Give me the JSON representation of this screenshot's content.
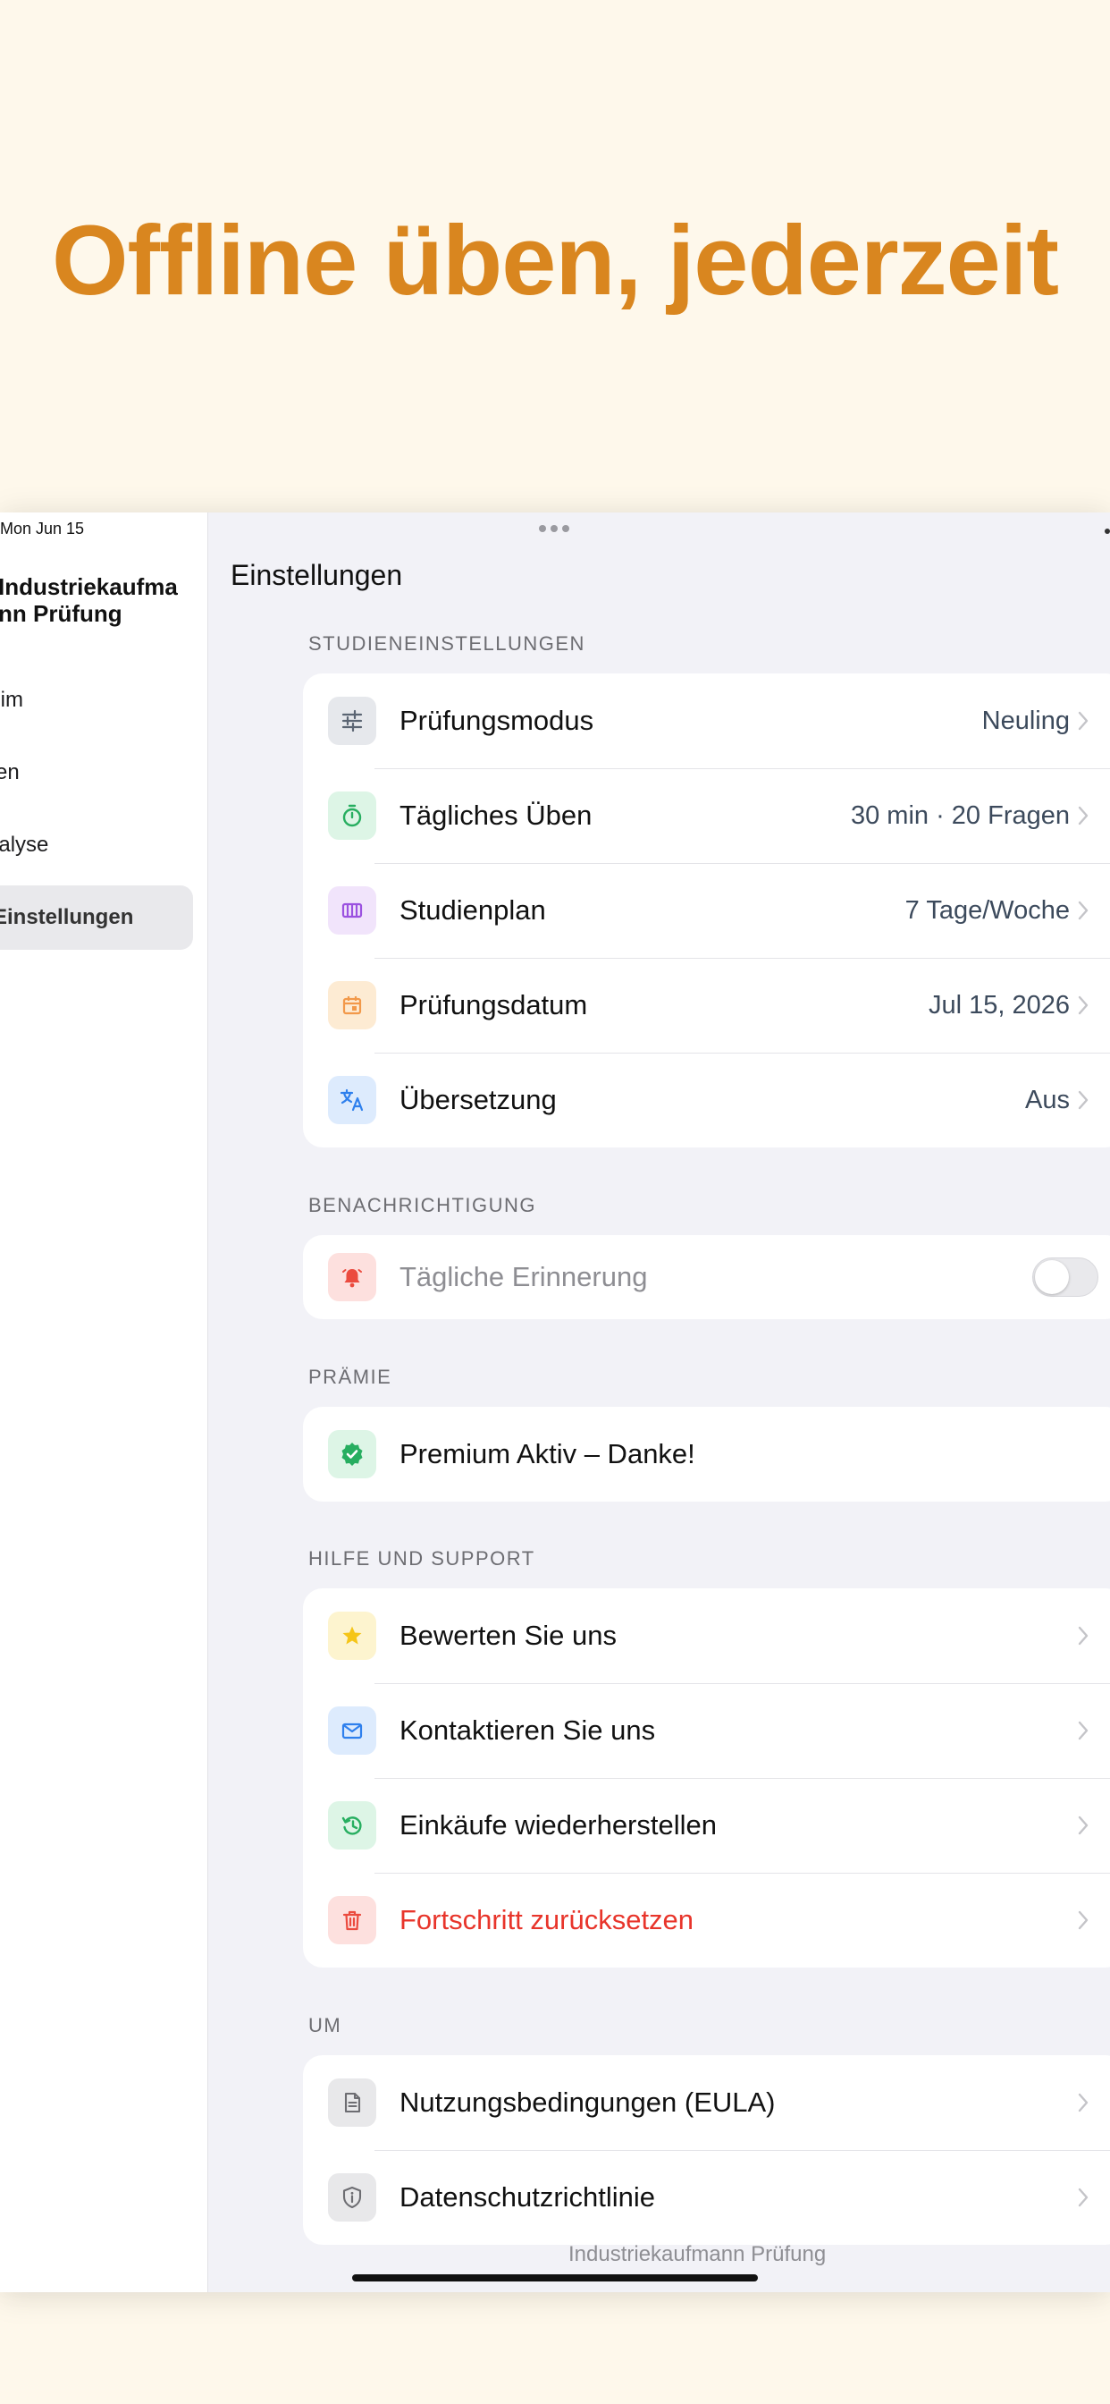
{
  "headline": "Offline üben, jederzeit",
  "colors": {
    "headline": "#D9861F",
    "background": "#FEF8EB"
  },
  "sidebar": {
    "date": "Mon Jun 15",
    "title": "Industriekaufmann Prüfung",
    "items": [
      {
        "label": "Heim"
      },
      {
        "label": "Lernen"
      },
      {
        "label": "Analyse"
      },
      {
        "label": "Einstellungen",
        "selected": true
      }
    ]
  },
  "main": {
    "title": "Einstellungen",
    "sections": {
      "study": {
        "label": "STUDIENEINSTELLUNGEN",
        "rows": [
          {
            "icon": "sliders-icon",
            "label": "Prüfungsmodus",
            "value": "Neuling"
          },
          {
            "icon": "timer-icon",
            "label": "Tägliches Üben",
            "value": "30 min · 20 Fragen"
          },
          {
            "icon": "calendar-week-icon",
            "label": "Studienplan",
            "value": "7 Tage/Woche"
          },
          {
            "icon": "calendar-icon",
            "label": "Prüfungsdatum",
            "value": "Jul 15, 2026"
          },
          {
            "icon": "translate-icon",
            "label": "Übersetzung",
            "value": "Aus"
          }
        ]
      },
      "notification": {
        "label": "BENACHRICHTIGUNG",
        "row": {
          "icon": "bell-icon",
          "label": "Tägliche Erinnerung",
          "enabled": false
        }
      },
      "premium": {
        "label": "PRÄMIE",
        "row": {
          "icon": "verified-badge-icon",
          "label": "Premium Aktiv – Danke!"
        }
      },
      "help": {
        "label": "HILFE UND SUPPORT",
        "rows": [
          {
            "icon": "star-icon",
            "label": "Bewerten Sie uns"
          },
          {
            "icon": "mail-icon",
            "label": "Kontaktieren Sie uns"
          },
          {
            "icon": "restore-icon",
            "label": "Einkäufe wiederherstellen"
          },
          {
            "icon": "trash-icon",
            "label": "Fortschritt zurücksetzen"
          }
        ]
      },
      "about": {
        "label": "UM",
        "rows": [
          {
            "icon": "document-icon",
            "label": "Nutzungsbedingungen (EULA)"
          },
          {
            "icon": "shield-info-icon",
            "label": "Datenschutzrichtlinie"
          }
        ]
      }
    },
    "footer": "Industriekaufmann Prüfung"
  }
}
